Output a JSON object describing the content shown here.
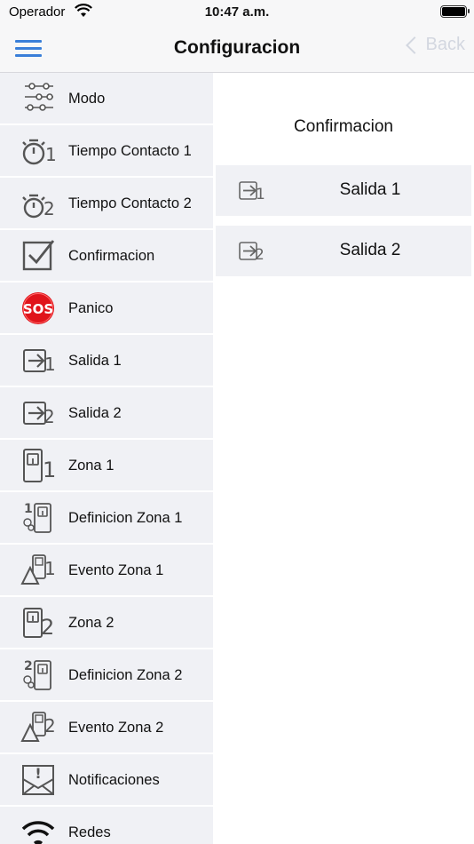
{
  "status_bar": {
    "carrier": "Operador",
    "time": "10:47 a.m."
  },
  "nav": {
    "title": "Configuracion",
    "back_label": "Back"
  },
  "sidebar": {
    "items": [
      {
        "label": "Modo",
        "icon": "sliders-icon"
      },
      {
        "label": "Tiempo Contacto 1",
        "icon": "stopwatch-1-icon",
        "num": "1"
      },
      {
        "label": "Tiempo Contacto 2",
        "icon": "stopwatch-2-icon",
        "num": "2"
      },
      {
        "label": "Confirmacion",
        "icon": "checkbox-icon"
      },
      {
        "label": "Panico",
        "icon": "sos-icon",
        "badge": "SOS"
      },
      {
        "label": "Salida 1",
        "icon": "output-1-icon",
        "num": "1"
      },
      {
        "label": "Salida 2",
        "icon": "output-2-icon",
        "num": "2"
      },
      {
        "label": "Zona 1",
        "icon": "zone-1-icon",
        "num": "1"
      },
      {
        "label": "Definicion Zona 1",
        "icon": "zone-definition-1-icon",
        "num": "1"
      },
      {
        "label": "Evento Zona 1",
        "icon": "zone-event-1-icon",
        "num": "1"
      },
      {
        "label": "Zona 2",
        "icon": "zone-2-icon",
        "num": "2"
      },
      {
        "label": "Definicion Zona 2",
        "icon": "zone-definition-2-icon",
        "num": "2"
      },
      {
        "label": "Evento Zona 2",
        "icon": "zone-event-2-icon",
        "num": "2"
      },
      {
        "label": "Notificaciones",
        "icon": "envelope-alert-icon",
        "mark": "!"
      },
      {
        "label": "Redes",
        "icon": "wifi-icon"
      }
    ]
  },
  "panel": {
    "title": "Confirmacion",
    "items": [
      {
        "label": "Salida 1",
        "icon": "output-1-icon",
        "num": "1"
      },
      {
        "label": "Salida 2",
        "icon": "output-2-icon",
        "num": "2"
      }
    ]
  },
  "colors": {
    "accent": "#3a7fd9",
    "row_bg": "#f0f1f5",
    "icon_gray": "#555555",
    "sos_red": "#e0141b"
  }
}
